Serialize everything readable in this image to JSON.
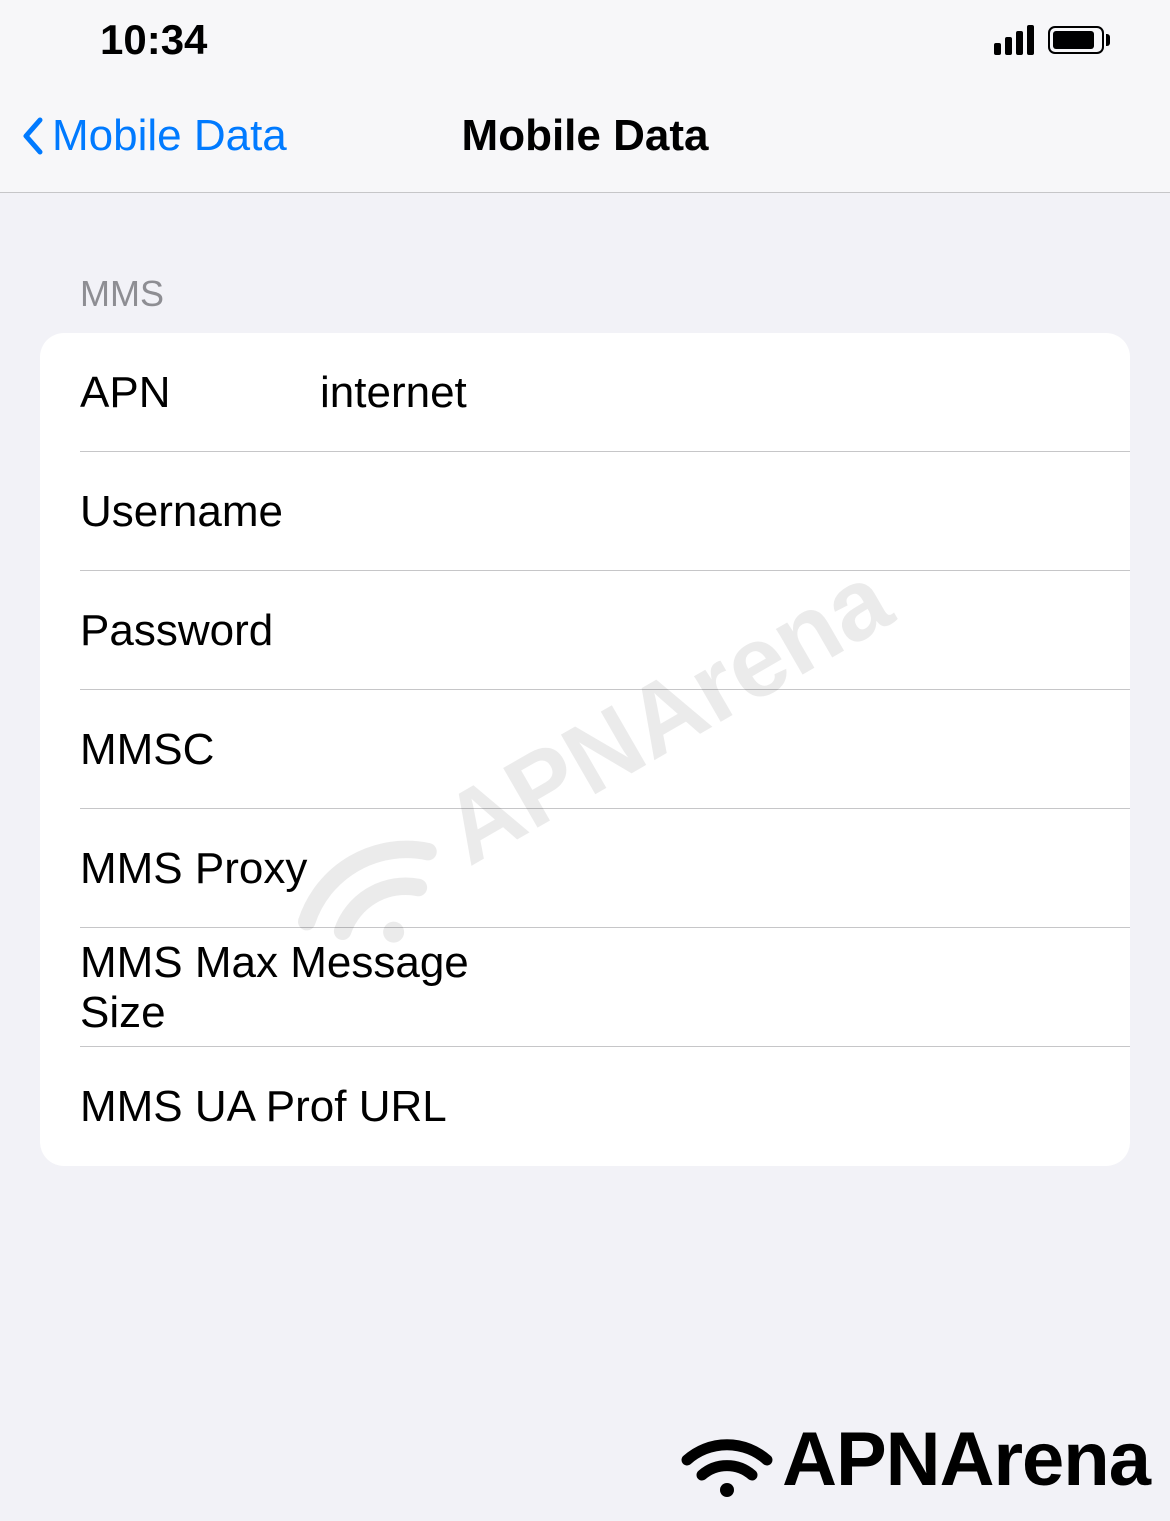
{
  "status_bar": {
    "time": "10:34"
  },
  "nav": {
    "back_label": "Mobile Data",
    "title": "Mobile Data"
  },
  "section": {
    "header": "MMS",
    "items": [
      {
        "label": "APN",
        "value": "internet"
      },
      {
        "label": "Username",
        "value": ""
      },
      {
        "label": "Password",
        "value": ""
      },
      {
        "label": "MMSC",
        "value": ""
      },
      {
        "label": "MMS Proxy",
        "value": ""
      },
      {
        "label": "MMS Max Message Size",
        "value": ""
      },
      {
        "label": "MMS UA Prof URL",
        "value": ""
      }
    ]
  },
  "watermark_text": "APNArena",
  "footer_text": "APNArena"
}
